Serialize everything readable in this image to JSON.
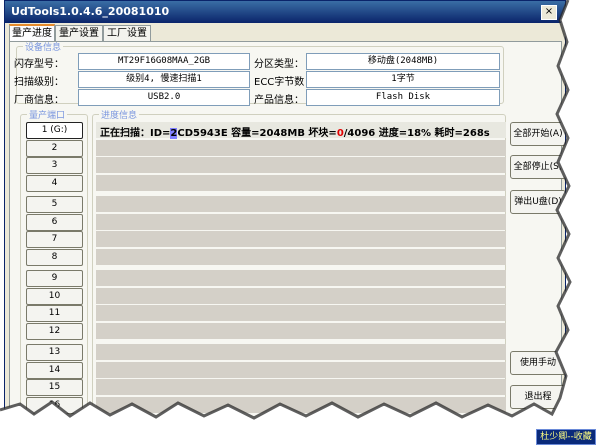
{
  "window": {
    "title": "UdTools1.0.4.6_20081010",
    "close_glyph": "×"
  },
  "tabs": [
    "量产进度",
    "量产设置",
    "工厂设置"
  ],
  "device_info": {
    "legend": "设备信息",
    "flash_model_label": "闪存型号：",
    "flash_model": "MT29F16G08MAA_2GB",
    "scan_level_label": "扫描级别：",
    "scan_level": "级别4, 慢速扫描1",
    "vendor_label": "厂商信息：",
    "vendor": "USB2.0",
    "partition_type_label": "分区类型：",
    "partition_type": "移动盘(2048MB)",
    "ecc_label": "ECC字节数：",
    "ecc": "1字节",
    "product_label": "产品信息：",
    "product": "Flash Disk"
  },
  "ports": {
    "legend": "量产端口",
    "items": [
      "1 (G:)",
      "2",
      "3",
      "4",
      "5",
      "6",
      "7",
      "8",
      "9",
      "10",
      "11",
      "12",
      "13",
      "14",
      "15",
      "16"
    ]
  },
  "progress": {
    "legend": "进度信息",
    "status_pre": "正在扫描：ID=",
    "status_id_hl": "2",
    "status_mid": "CD5943E 容量=2048MB 坏块=",
    "status_bad": "0",
    "status_post": "/4096 进度=18% 耗时=268s"
  },
  "buttons": {
    "start_all": "全部开始(A)",
    "stop_all": "全部停止(S)",
    "eject": "弹出U盘(D)",
    "manual": "使用手动",
    "exit": "退出程"
  },
  "watermark": "杜少卿--收藏"
}
